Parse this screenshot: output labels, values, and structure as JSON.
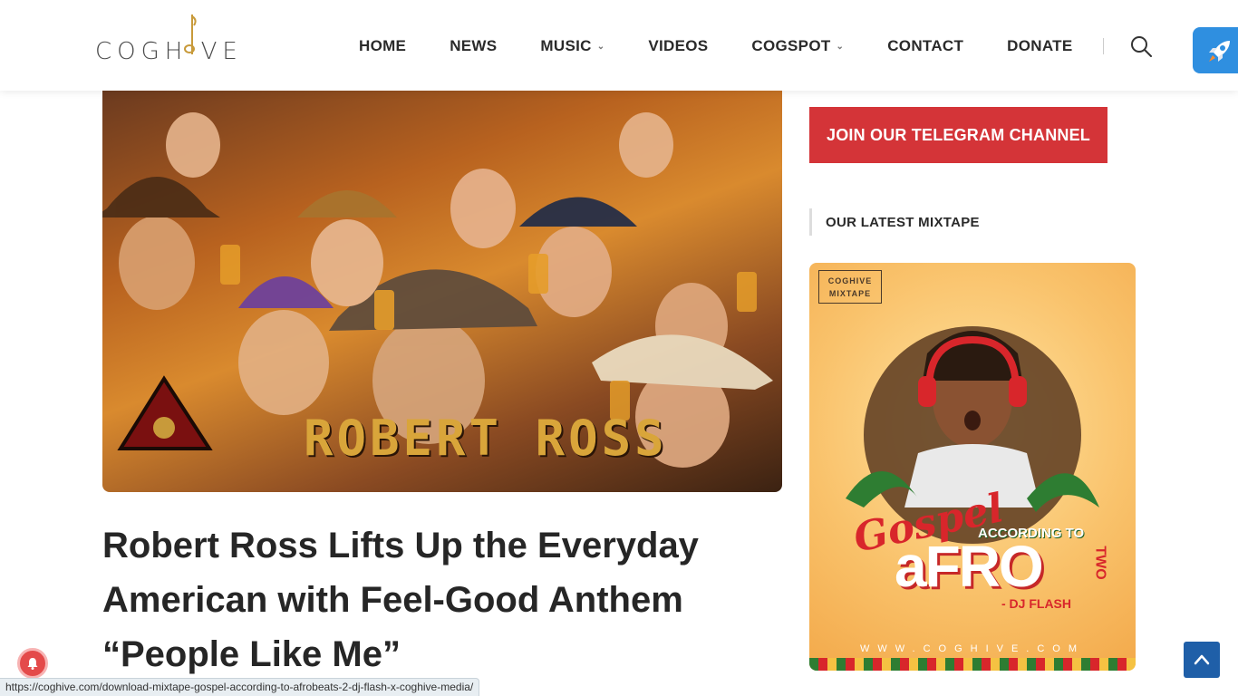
{
  "header": {
    "logo_text": "COGH VE",
    "nav": [
      {
        "label": "HOME",
        "has_dropdown": false
      },
      {
        "label": "NEWS",
        "has_dropdown": false
      },
      {
        "label": "MUSIC",
        "has_dropdown": true
      },
      {
        "label": "VIDEOS",
        "has_dropdown": false
      },
      {
        "label": "COGSPOT",
        "has_dropdown": true
      },
      {
        "label": "CONTACT",
        "has_dropdown": false
      },
      {
        "label": "DONATE",
        "has_dropdown": false
      }
    ],
    "search_icon": "search-icon",
    "rocket_icon": "rocket-icon",
    "rocket_color": "#2f8fe0"
  },
  "post": {
    "image_banner_text": "ROBERT ROSS",
    "title": "Robert Ross Lifts Up the Everyday American with Feel-Good Anthem “People Like Me”"
  },
  "sidebar": {
    "telegram_label": "JOIN OUR TELEGRAM CHANNEL",
    "telegram_color": "#d43438",
    "widget_title": "OUR LATEST MIXTAPE",
    "mixtape": {
      "logo_line1": "COGHIVE",
      "logo_line2": "MIXTAPE",
      "gospel": "Gospel",
      "according": "ACCORDING TO",
      "afro": "aFRO",
      "two": "TWO",
      "dj": "- DJ FLASH",
      "url": "WWW.COGHIVE.COM"
    }
  },
  "status_bar": {
    "url": "https://coghive.com/download-mixtape-gospel-according-to-afrobeats-2-dj-flash-x-coghive-media/"
  },
  "accent": {
    "to_top": "#1f5fa8",
    "bell": "#e44a4a"
  }
}
